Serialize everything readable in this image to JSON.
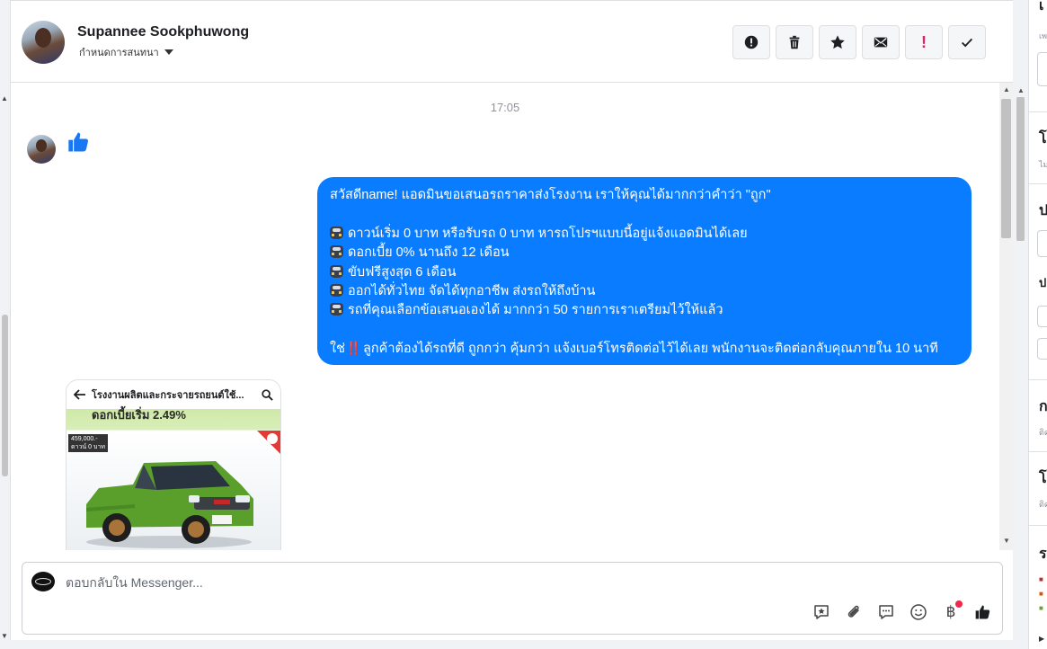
{
  "header": {
    "contact_name": "Supannee Sookphuwong",
    "conversation_settings": "กำหนดการสนทนา",
    "actions": [
      {
        "name": "mark-spam-button",
        "icon": "alert-circle-icon"
      },
      {
        "name": "delete-button",
        "icon": "trash-icon"
      },
      {
        "name": "star-button",
        "icon": "star-icon"
      },
      {
        "name": "mark-unread-button",
        "icon": "envelope-icon"
      },
      {
        "name": "follow-up-button",
        "icon": "exclamation-icon",
        "label": "!"
      },
      {
        "name": "mark-done-button",
        "icon": "checkmark-icon"
      }
    ]
  },
  "chat": {
    "timestamp": "17:05",
    "incoming_message_icon": "thumbs-up-icon",
    "outgoing_message": {
      "line1": "สวัสดีname! แอดมินขอเสนอรถราคาส่งโรงงาน เราให้คุณได้มากกว่าคำว่า \"ถูก\"",
      "bullets": [
        "ดาวน์เริ่ม 0 บาท หรือรับรถ 0 บาท หารถโปรฯแบบนี้อยู่แจ้งแอดมินได้เลย",
        "ดอกเบี้ย 0% นานถึง 12 เดือน",
        "ขับฟรีสูงสุด 6 เดือน",
        "ออกได้ทั่วไทย จัดได้ทุกอาชีพ ส่งรถให้ถึงบ้าน",
        "รถที่คุณเลือกข้อเสนอเองได้ มากกว่า 50 รายการเราเตรียมไว้ให้แล้ว"
      ],
      "closing_prefix": "ใช่",
      "closing_emoji": "‼️",
      "closing_text": "ลูกค้าต้องได้รถที่ดี ถูกกว่า คุ้มกว่า แจ้งเบอร์โทรติดต่อไว้ได้เลย พนักงานจะติดต่อกลับคุณภายใน 10 นาที"
    },
    "card": {
      "title": "โรงงานผลิตและกระจายรถยนต์ใช้...",
      "rate_text": "ดอกเบี้ยเริ่ม 2.49%",
      "price_text": "459,000.-",
      "price_sub": "ดาวน์ 0 บาท"
    }
  },
  "composer": {
    "placeholder": "ตอบกลับใน Messenger...",
    "tools": [
      "saved-reply-icon",
      "attachment-icon",
      "message-icon",
      "emoji-icon",
      "payment-icon",
      "thumbs-up-icon"
    ],
    "payment_symbol": "฿"
  },
  "right_panel": {
    "headings": [
      "เ",
      "โ",
      "ป",
      "ก",
      "โ",
      "ร"
    ],
    "subtexts": [
      "เพ",
      "ไม",
      "ป",
      "ติด",
      "ติด"
    ]
  },
  "colors": {
    "bubble": "#0a7cff",
    "accent": "#1877f2",
    "alert": "#e0245e"
  }
}
